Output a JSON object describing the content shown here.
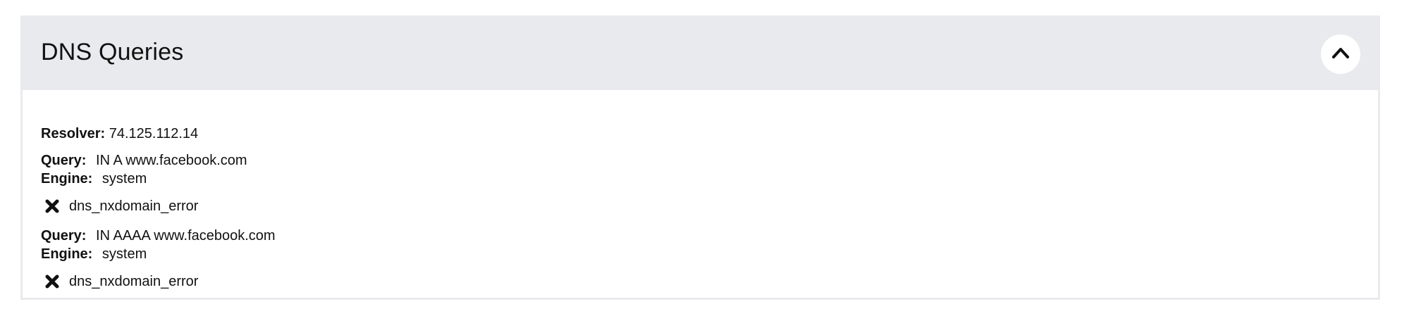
{
  "panel": {
    "title": "DNS Queries",
    "collapse_icon": "chevron-up-icon"
  },
  "resolver": {
    "label": "Resolver:",
    "value": "74.125.112.14"
  },
  "queries": [
    {
      "query_label": "Query:",
      "query_value": "IN A www.facebook.com",
      "engine_label": "Engine:",
      "engine_value": "system",
      "error_icon": "cross-icon",
      "error": "dns_nxdomain_error"
    },
    {
      "query_label": "Query:",
      "query_value": "IN AAAA www.facebook.com",
      "engine_label": "Engine:",
      "engine_value": "system",
      "error_icon": "cross-icon",
      "error": "dns_nxdomain_error"
    }
  ],
  "colors": {
    "header_background": "#e9eaed",
    "text": "#111111"
  }
}
